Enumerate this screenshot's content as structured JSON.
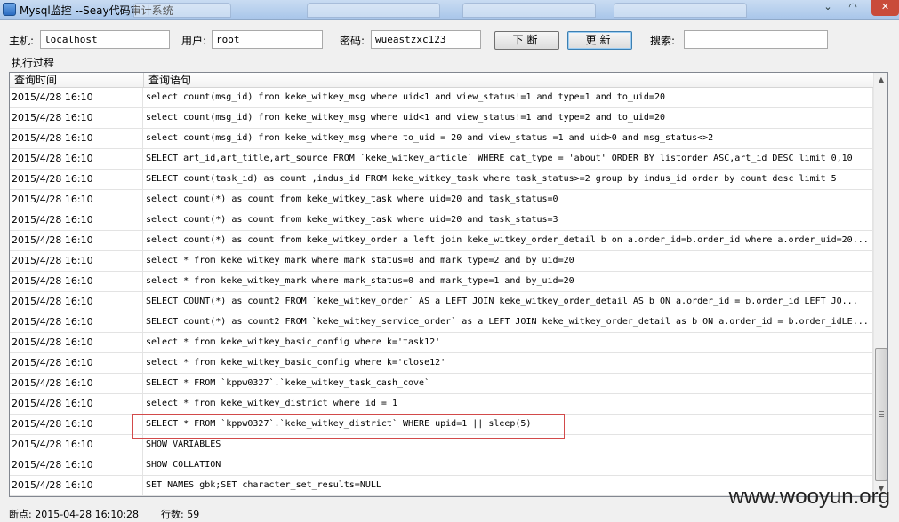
{
  "window": {
    "title": "Mysql监控 --Seay代码审计系统"
  },
  "toolbar": {
    "host_label": "主机:",
    "host_value": "localhost",
    "user_label": "用户:",
    "user_value": "root",
    "password_label": "密码:",
    "password_value": "wueastzxc123",
    "breakpoint_button": "下断",
    "refresh_button": "更新",
    "search_label": "搜索:",
    "search_value": ""
  },
  "log": {
    "group_label": "执行过程",
    "columns": [
      "查询时间",
      "查询语句"
    ],
    "rows": [
      {
        "time": "2015/4/28 16:10",
        "query": "select count(msg_id) from keke_witkey_msg where uid<1 and view_status!=1 and type=1 and  to_uid=20"
      },
      {
        "time": "2015/4/28 16:10",
        "query": "select count(msg_id) from keke_witkey_msg where uid<1 and view_status!=1 and type=2 and  to_uid=20"
      },
      {
        "time": "2015/4/28 16:10",
        "query": "select count(msg_id) from keke_witkey_msg where to_uid = 20 and view_status!=1 and uid>0 and msg_status<>2"
      },
      {
        "time": "2015/4/28 16:10",
        "query": "SELECT art_id,art_title,art_source FROM `keke_witkey_article` WHERE cat_type = 'about' ORDER BY listorder ASC,art_id DESC limit 0,10"
      },
      {
        "time": "2015/4/28 16:10",
        "query": "SELECT count(task_id) as count ,indus_id FROM  keke_witkey_task where task_status>=2 group by indus_id order by count desc limit 5"
      },
      {
        "time": "2015/4/28 16:10",
        "query": "select count(*) as count from keke_witkey_task where uid=20 and task_status=0"
      },
      {
        "time": "2015/4/28 16:10",
        "query": "select count(*) as count from keke_witkey_task where uid=20 and task_status=3"
      },
      {
        "time": "2015/4/28 16:10",
        "query": "select count(*) as count from keke_witkey_order a left join keke_witkey_order_detail b on a.order_id=b.order_id where a.order_uid=20..."
      },
      {
        "time": "2015/4/28 16:10",
        "query": "select * from keke_witkey_mark where mark_status=0 and mark_type=2 and by_uid=20"
      },
      {
        "time": "2015/4/28 16:10",
        "query": "select * from keke_witkey_mark where mark_status=0 and mark_type=1 and by_uid=20"
      },
      {
        "time": "2015/4/28 16:10",
        "query": "SELECT COUNT(*) as count2 FROM `keke_witkey_order` AS a  LEFT JOIN keke_witkey_order_detail AS b ON a.order_id = b.order_id  LEFT JO..."
      },
      {
        "time": "2015/4/28 16:10",
        "query": "SELECT count(*) as count2 FROM `keke_witkey_service_order` as a LEFT JOIN keke_witkey_order_detail as b ON a.order_id = b.order_idLE..."
      },
      {
        "time": "2015/4/28 16:10",
        "query": "select * from keke_witkey_basic_config where k='task12'"
      },
      {
        "time": "2015/4/28 16:10",
        "query": "select * from keke_witkey_basic_config where k='close12'"
      },
      {
        "time": "2015/4/28 16:10",
        "query": "SELECT * FROM `kppw0327`.`keke_witkey_task_cash_cove`"
      },
      {
        "time": "2015/4/28 16:10",
        "query": "select * from keke_witkey_district where id = 1"
      },
      {
        "time": "2015/4/28 16:10",
        "query": "SELECT * FROM `kppw0327`.`keke_witkey_district` WHERE upid=1 || sleep(5)"
      },
      {
        "time": "2015/4/28 16:10",
        "query": "SHOW VARIABLES"
      },
      {
        "time": "2015/4/28 16:10",
        "query": "SHOW COLLATION"
      },
      {
        "time": "2015/4/28 16:10",
        "query": "SET NAMES gbk;SET character_set_results=NULL"
      }
    ],
    "highlight_color": "#d24a4a"
  },
  "statusbar": {
    "breakpoint": "断点: 2015-04-28 16:10:28",
    "rowcount": "行数: 59"
  },
  "watermark": "www.wooyun.org"
}
